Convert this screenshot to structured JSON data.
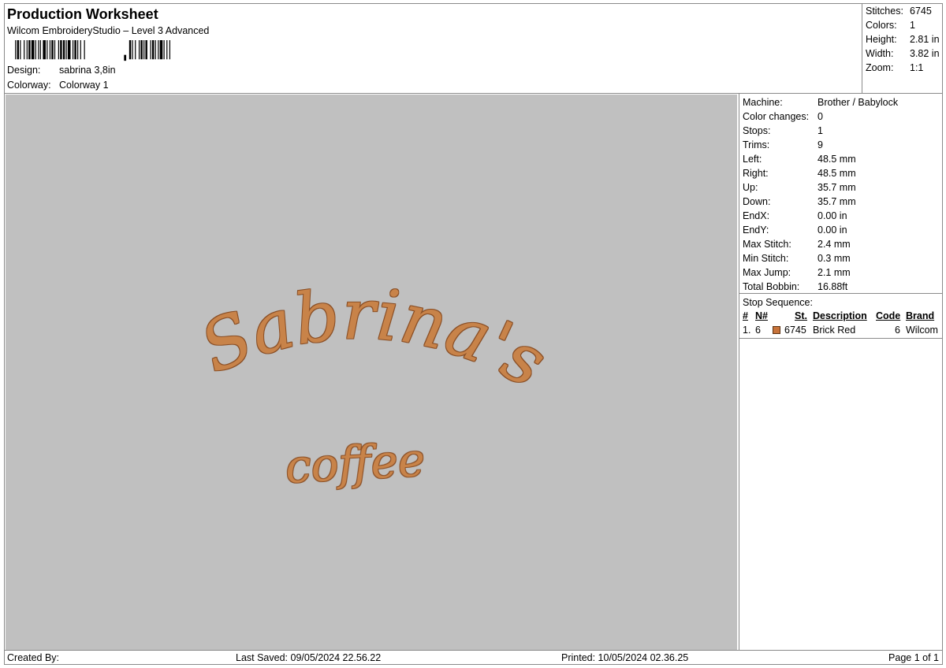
{
  "header": {
    "title": "Production Worksheet",
    "subtitle": "Wilcom EmbroideryStudio – Level 3 Advanced",
    "design_label": "Design:",
    "design_value": "sabrina 3,8in",
    "colorway_label": "Colorway:",
    "colorway_value": "Colorway 1"
  },
  "stats": {
    "stitches_label": "Stitches:",
    "stitches_value": "6745",
    "colors_label": "Colors:",
    "colors_value": "1",
    "height_label": "Height:",
    "height_value": "2.81 in",
    "width_label": "Width:",
    "width_value": "3.82 in",
    "zoom_label": "Zoom:",
    "zoom_value": "1:1"
  },
  "machine_info": [
    {
      "label": "Machine:",
      "value": "Brother / Babylock"
    },
    {
      "label": "Color changes:",
      "value": "0"
    },
    {
      "label": "Stops:",
      "value": "1"
    },
    {
      "label": "Trims:",
      "value": "9"
    },
    {
      "label": "Left:",
      "value": "48.5 mm"
    },
    {
      "label": "Right:",
      "value": "48.5 mm"
    },
    {
      "label": "Up:",
      "value": "35.7 mm"
    },
    {
      "label": "Down:",
      "value": "35.7 mm"
    },
    {
      "label": "EndX:",
      "value": "0.00 in"
    },
    {
      "label": "EndY:",
      "value": "0.00 in"
    },
    {
      "label": "Max Stitch:",
      "value": "2.4 mm"
    },
    {
      "label": "Min Stitch:",
      "value": "0.3 mm"
    },
    {
      "label": "Max Jump:",
      "value": "2.1 mm"
    },
    {
      "label": "Total Bobbin:",
      "value": "16.88ft"
    }
  ],
  "stop_sequence": {
    "title": "Stop Sequence:",
    "columns": {
      "num": "#",
      "n": "N#",
      "st": "St.",
      "description": "Description",
      "code": "Code",
      "brand": "Brand"
    },
    "rows": [
      {
        "num": "1.",
        "n": "6",
        "st": "6745",
        "description": "Brick Red",
        "code": "6",
        "brand": "Wilcom",
        "color": "#c8733a"
      }
    ]
  },
  "design_preview": {
    "line1": "Sabrina's",
    "line2": "coffee",
    "thread_color": "#c8834a",
    "background_color": "#c0c0c0"
  },
  "footer": {
    "created_by": "Created By:",
    "last_saved": "Last Saved: 09/05/2024 22.56.22",
    "printed": "Printed: 10/05/2024 02.36.25",
    "page": "Page 1 of 1"
  }
}
